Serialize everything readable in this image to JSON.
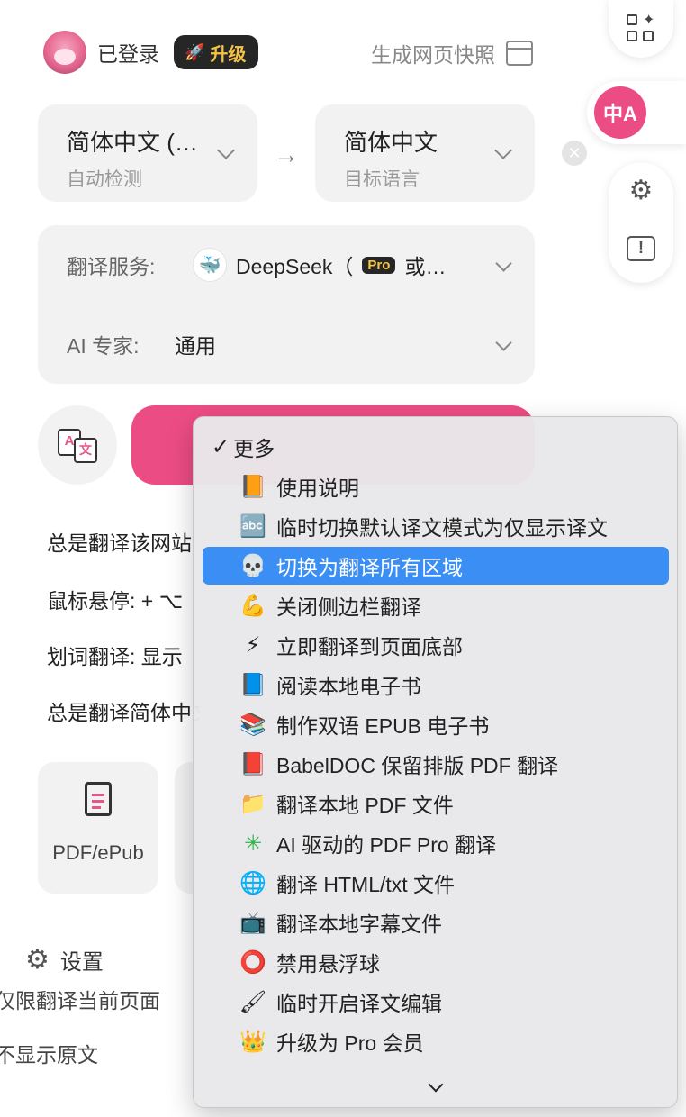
{
  "header": {
    "logged_in": "已登录",
    "upgrade": "升级",
    "snapshot": "生成网页快照"
  },
  "source_lang": {
    "name": "简体中文 (…",
    "hint": "自动检测"
  },
  "target_lang": {
    "name": "简体中文",
    "hint": "目标语言"
  },
  "service": {
    "label": "翻译服务:",
    "value_pre": "DeepSeek（",
    "pro": "Pro",
    "value_post": "或…",
    "expert_label": "AI 专家:",
    "expert_value": "通用"
  },
  "options": [
    "总是翻译该网站",
    "鼠标悬停: + ⌥",
    "划词翻译: 显示",
    "总是翻译简体中文"
  ],
  "tiles": {
    "pdf": "PDF/ePub"
  },
  "settings": "设置",
  "background_fragments": [
    "仅限翻译当前页面",
    "不显示原文"
  ],
  "fab": {
    "translate_glyph": "中A"
  },
  "menu": {
    "header": "更多",
    "items": [
      {
        "icon": "📙",
        "label": "使用说明"
      },
      {
        "icon": "🔤",
        "label": "临时切换默认译文模式为仅显示译文"
      },
      {
        "icon": "💀",
        "label": "切换为翻译所有区域"
      },
      {
        "icon": "💪",
        "label": "关闭侧边栏翻译"
      },
      {
        "icon": "⚡",
        "label": "立即翻译到页面底部"
      },
      {
        "icon": "📘",
        "label": "阅读本地电子书"
      },
      {
        "icon": "📚",
        "label": "制作双语 EPUB 电子书"
      },
      {
        "icon": "📕",
        "label": "BabelDOC 保留排版 PDF 翻译"
      },
      {
        "icon": "📁",
        "label": "翻译本地 PDF 文件"
      },
      {
        "icon": "✳",
        "label": "AI 驱动的 PDF Pro 翻译"
      },
      {
        "icon": "🌐",
        "label": "翻译 HTML/txt 文件"
      },
      {
        "icon": "📺",
        "label": "翻译本地字幕文件"
      },
      {
        "icon": "⭕",
        "label": "禁用悬浮球"
      },
      {
        "icon": "🖌",
        "label": "临时开启译文编辑"
      },
      {
        "icon": "👑",
        "label": "升级为 Pro 会员"
      }
    ],
    "selected_index": 2
  }
}
